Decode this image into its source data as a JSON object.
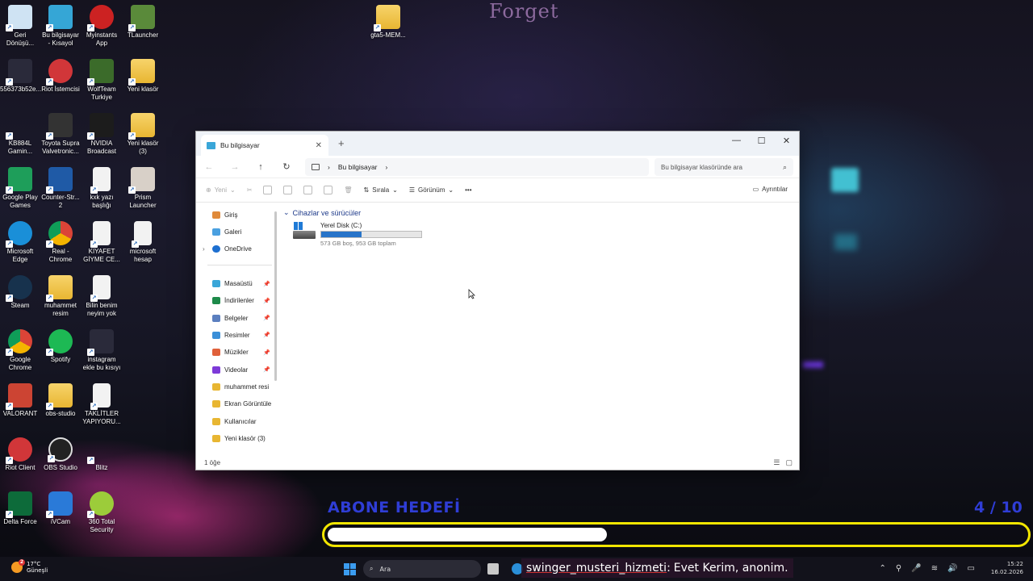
{
  "desktop": {
    "watermark": "Forget",
    "icons": [
      {
        "label": "Geri Dönüşü...",
        "icon": "recycle-bin-icon"
      },
      {
        "label": "Bu bilgisayar - Kısayol",
        "icon": "monitor-icon"
      },
      {
        "label": "Myinstants App",
        "icon": "myinstants-icon"
      },
      {
        "label": "TLauncher",
        "icon": "tlauncher-icon"
      },
      {
        "label": "gta5-MEM...",
        "icon": "zip-folder-icon"
      },
      {
        "label": "556373b52e...",
        "icon": "image-icon"
      },
      {
        "label": "Riot İstemcisi",
        "icon": "riot-icon"
      },
      {
        "label": "WolfTeam Turkiye",
        "icon": "wolfteam-icon"
      },
      {
        "label": "Yeni klasör",
        "icon": "folder-icon"
      },
      {
        "label": "KB884L Gamin...",
        "icon": "mouse-app-icon"
      },
      {
        "label": "Toyota Supra Valvetronic...",
        "icon": "car-image-icon"
      },
      {
        "label": "NVIDIA Broadcast",
        "icon": "nvidia-icon"
      },
      {
        "label": "Yeni klasör (3)",
        "icon": "folder-icon"
      },
      {
        "label": "Google Play Games",
        "icon": "google-play-games-icon"
      },
      {
        "label": "Counter-Str... 2",
        "icon": "counter-strike-icon"
      },
      {
        "label": "kxk yazı başlığı",
        "icon": "document-icon"
      },
      {
        "label": "Prism Launcher",
        "icon": "prism-launcher-icon"
      },
      {
        "label": "Microsoft Edge",
        "icon": "edge-icon"
      },
      {
        "label": "Real - Chrome",
        "icon": "chrome-icon"
      },
      {
        "label": "KIYAFET GİYME CE...",
        "icon": "document-icon"
      },
      {
        "label": "microsoft hesap",
        "icon": "document-icon"
      },
      {
        "label": "Steam",
        "icon": "steam-icon"
      },
      {
        "label": "muhammet resim",
        "icon": "folder-icon"
      },
      {
        "label": "Bilin benim neyim yok",
        "icon": "document-icon"
      },
      {
        "label": "Google Chrome",
        "icon": "chrome-icon"
      },
      {
        "label": "Spotify",
        "icon": "spotify-icon"
      },
      {
        "label": "instagram ekle bu kısıyı",
        "icon": "image-icon"
      },
      {
        "label": "VALORANT",
        "icon": "valorant-icon"
      },
      {
        "label": "obs-studio",
        "icon": "folder-icon"
      },
      {
        "label": "TAKLİTLER YAPIYORU...",
        "icon": "document-icon"
      },
      {
        "label": "Riot Client",
        "icon": "riot-icon"
      },
      {
        "label": "OBS Studio",
        "icon": "obs-icon"
      },
      {
        "label": "Blitz",
        "icon": "blitz-icon"
      },
      {
        "label": "Delta Force",
        "icon": "delta-force-icon"
      },
      {
        "label": "iVCam",
        "icon": "ivcam-icon"
      },
      {
        "label": "360 Total Security",
        "icon": "360-security-icon"
      }
    ]
  },
  "explorer": {
    "tab_title": "Bu bilgisayar",
    "new_tab": "+",
    "controls": {
      "minimize": "—",
      "maximize": "☐",
      "close": "✕"
    },
    "breadcrumb": "Bu bilgisayar",
    "search_placeholder": "Bu bilgisayar klasöründe ara",
    "toolbar": {
      "new": "Yeni",
      "sort": "Sırala",
      "view": "Görünüm",
      "more": "•••",
      "details": "Ayrıntılar"
    },
    "sidebar": {
      "home": "Giriş",
      "gallery": "Galeri",
      "onedrive": "OneDrive",
      "pinned": [
        {
          "label": "Masaüstü",
          "color": "#3aa6d8"
        },
        {
          "label": "İndirilenler",
          "color": "#1d8a4a"
        },
        {
          "label": "Belgeler",
          "color": "#5b7fbf"
        },
        {
          "label": "Resimler",
          "color": "#3a8fd8"
        },
        {
          "label": "Müzikler",
          "color": "#e0603a"
        },
        {
          "label": "Videolar",
          "color": "#7d3ad8"
        }
      ],
      "folders": [
        "muhammet resi",
        "Ekran Görüntüle",
        "Kullanıcılar",
        "Yeni klasör (3)"
      ]
    },
    "group_title": "Cihazlar ve sürücüler",
    "drive": {
      "name": "Yerel Disk (C:)",
      "used_fraction": 0.4,
      "summary": "573 GB boş, 953 GB toplam"
    },
    "status": "1 öğe"
  },
  "overlay": {
    "goal_label": "ABONE HEDEFİ",
    "goal_count": "4  / 10",
    "goal_progress": 0.4,
    "accent": "#f2e600",
    "label_color": "#2f3dd6"
  },
  "taskbar": {
    "temperature": "17°C",
    "weather": "Güneşli",
    "weather_badge": "2",
    "search": "Ara",
    "chat_user": "swinger_musteri_hizmeti",
    "chat_message": "Evet Kerim, anonim.",
    "time": "15:22",
    "date": "16.02.2026"
  }
}
